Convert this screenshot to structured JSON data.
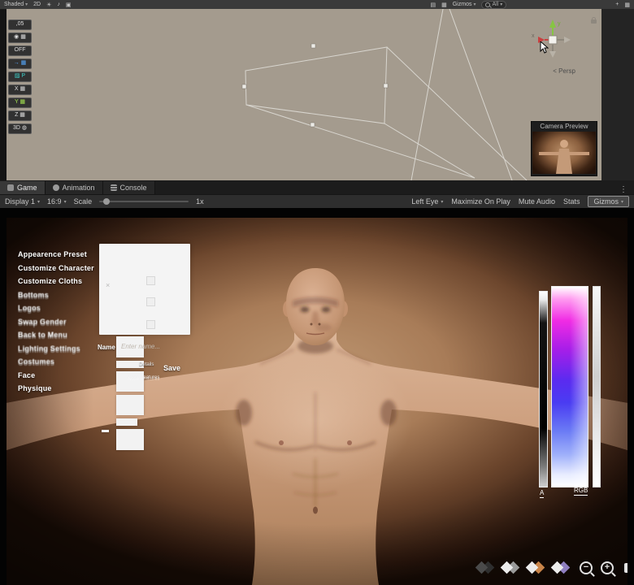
{
  "colors": {
    "scene_background": "#a49b8e",
    "editor_chrome": "#3a3a3a",
    "skin_tone": "#c99d7d",
    "game_bg_center": "#bd9671",
    "gizmo_green": "#8bc543",
    "gizmo_red": "#d84b4b",
    "picker_magenta": "#f02be4",
    "picker_blue": "#4a3cf2"
  },
  "icons": {
    "chevron": "▾",
    "light": "☀",
    "audio": "♪",
    "fx": "▣",
    "tool_a": "▤",
    "tool_b": "▦",
    "grid": "▦",
    "menu_dots": "⋮",
    "plus": "+",
    "close": "×",
    "zoom_out": "−",
    "zoom_in": "+"
  },
  "top_toolbar": {
    "shaded": "Shaded",
    "mode_2d": "2D",
    "gizmos": "Gizmos",
    "search_value": "All"
  },
  "scene_view": {
    "overlay_buttons": [
      {
        "label": ",05"
      },
      {
        "label": "◉ ▦"
      },
      {
        "label": "OFF"
      },
      {
        "label": "→ ▦"
      },
      {
        "label": "▨ P"
      },
      {
        "label": "X ▦"
      },
      {
        "label": "Y ▦"
      },
      {
        "label": "Z ▦"
      },
      {
        "label": "3D ◍"
      }
    ],
    "gizmo": {
      "y_label": "y",
      "x_label": "x",
      "persp": "< Persp"
    },
    "camera_preview": {
      "title": "Camera Preview"
    }
  },
  "tabs": [
    {
      "label": "Game"
    },
    {
      "label": "Animation"
    },
    {
      "label": "Console"
    }
  ],
  "game_toolbar": {
    "display": "Display 1",
    "aspect": "16:9",
    "scale_label": "Scale",
    "scale_value": "1x",
    "eye": "Left Eye",
    "maximize": "Maximize On Play",
    "mute": "Mute Audio",
    "stats": "Stats",
    "gizmos": "Gizmos"
  },
  "game_ui": {
    "menu_items": [
      {
        "label": "Appearence Preset"
      },
      {
        "label": "Customize Character"
      },
      {
        "label": "Customize Cloths"
      },
      {
        "label": "Bottoms"
      },
      {
        "label": "Logos"
      },
      {
        "label": "Swap Gender"
      },
      {
        "label": "Back to Menu"
      },
      {
        "label": "Lighting Settings"
      },
      {
        "label": "Costumes"
      },
      {
        "label": "Face"
      },
      {
        "label": "Physique"
      }
    ],
    "name_label": "Name",
    "name_placeholder": "Enter name...",
    "details_label": "Details",
    "save_label": "Save",
    "nose_label": "Nose Features",
    "picker": {
      "a_label": "A",
      "rgb_label": "RGB"
    }
  }
}
